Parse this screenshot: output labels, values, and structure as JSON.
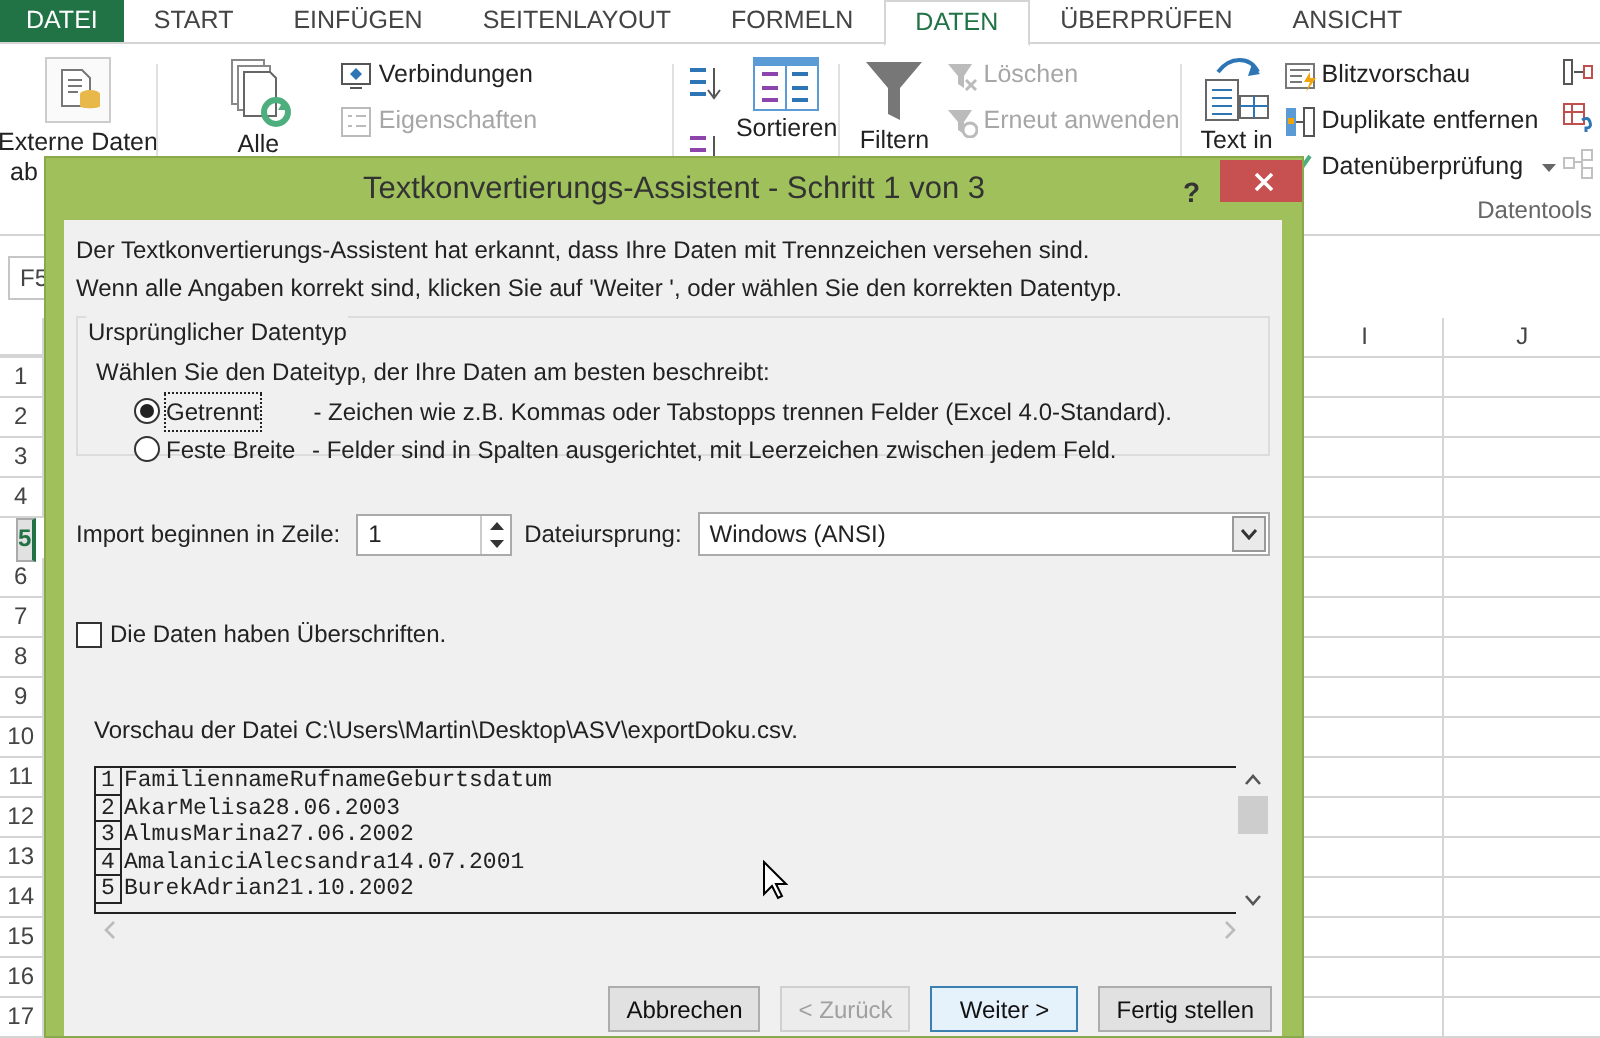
{
  "ribbon_tabs": [
    {
      "label": "DATEI",
      "kind": "file",
      "selected": false
    },
    {
      "label": "START",
      "kind": "tab",
      "selected": false
    },
    {
      "label": "EINFÜGEN",
      "kind": "tab",
      "selected": false
    },
    {
      "label": "SEITENLAYOUT",
      "kind": "tab",
      "selected": false
    },
    {
      "label": "FORMELN",
      "kind": "tab",
      "selected": false
    },
    {
      "label": "DATEN",
      "kind": "tab",
      "selected": true
    },
    {
      "label": "ÜBERPRÜFEN",
      "kind": "tab",
      "selected": false
    },
    {
      "label": "ANSICHT",
      "kind": "tab",
      "selected": false
    }
  ],
  "ribbon": {
    "columns": [
      {
        "kind": "large",
        "lines": [
          "Externe Daten",
          "ab"
        ]
      },
      {
        "kind": "large",
        "lines": [
          "Alle"
        ]
      },
      {
        "kind": "small",
        "items": [
          {
            "label": "Verbindungen",
            "disabled": false
          },
          {
            "label": "Eigenschaften",
            "disabled": true
          }
        ]
      },
      {
        "kind": "sort",
        "items": [
          {
            "disabled": false
          },
          {
            "disabled": false
          }
        ]
      },
      {
        "kind": "large",
        "lines": [
          "Sortieren"
        ]
      },
      {
        "kind": "large",
        "lines": [
          "Filtern"
        ]
      },
      {
        "kind": "small",
        "items": [
          {
            "label": "Löschen",
            "disabled": true
          },
          {
            "label": "Erneut anwenden",
            "disabled": true
          }
        ]
      },
      {
        "kind": "large",
        "lines": [
          "Text in"
        ]
      },
      {
        "kind": "small",
        "items": [
          {
            "label": "Blitzvorschau",
            "disabled": false
          },
          {
            "label": "Duplikate entfernen",
            "disabled": false
          },
          {
            "label": "Datenüberprüfung",
            "disabled": false,
            "dropdown": true
          }
        ]
      },
      {
        "kind": "icons",
        "items": [
          {
            "disabled": false
          },
          {
            "disabled": false
          },
          {
            "disabled": true
          }
        ]
      }
    ],
    "group_label": "Datentools"
  },
  "name_box": "F5",
  "columns": [
    "I",
    "J"
  ],
  "rows": [
    {
      "label": "1",
      "selected": false
    },
    {
      "label": "2",
      "selected": false
    },
    {
      "label": "3",
      "selected": false
    },
    {
      "label": "4",
      "selected": false
    },
    {
      "label": "5",
      "selected": true
    },
    {
      "label": "6",
      "selected": false
    },
    {
      "label": "7",
      "selected": false
    },
    {
      "label": "8",
      "selected": false
    },
    {
      "label": "9",
      "selected": false
    },
    {
      "label": "10",
      "selected": false
    },
    {
      "label": "11",
      "selected": false
    },
    {
      "label": "12",
      "selected": false
    },
    {
      "label": "13",
      "selected": false
    },
    {
      "label": "14",
      "selected": false
    },
    {
      "label": "15",
      "selected": false
    },
    {
      "label": "16",
      "selected": false
    },
    {
      "label": "17",
      "selected": false
    }
  ],
  "dialog": {
    "title": "Textkonvertierungs-Assistent - Schritt 1 von 3",
    "help": "?",
    "intro": [
      "Der Textkonvertierungs-Assistent hat erkannt, dass Ihre Daten mit Trennzeichen versehen sind.",
      "Wenn alle Angaben korrekt sind, klicken Sie auf 'Weiter ', oder wählen Sie den korrekten Datentyp."
    ],
    "group_title": "Ursprünglicher Datentyp",
    "prompt": "Wählen Sie den Dateityp, der Ihre Daten am besten beschreibt:",
    "options": [
      {
        "label": "Getrennt",
        "description": "- Zeichen wie z.B. Kommas oder Tabstopps trennen Felder (Excel 4.0-Standard).",
        "selected": true
      },
      {
        "label": "Feste Breite",
        "description": "- Felder sind in Spalten ausgerichtet, mit Leerzeichen zwischen jedem Feld.",
        "selected": false
      }
    ],
    "start_row": {
      "label": "Import beginnen in Zeile:",
      "value": "1"
    },
    "origin": {
      "label": "Dateiursprung:",
      "value": "Windows (ANSI)"
    },
    "headers": {
      "label": "Die Daten haben Überschriften.",
      "checked": false
    },
    "preview": {
      "label": "Vorschau der Datei C:\\Users\\Martin\\Desktop\\ASV\\exportDoku.csv.",
      "lines": [
        {
          "number": "1",
          "text": "FamiliennameRufnameGeburtsdatum"
        },
        {
          "number": "2",
          "text": "AkarMelisa28.06.2003"
        },
        {
          "number": "3",
          "text": "AlmusMarina27.06.2002"
        },
        {
          "number": "4",
          "text": "AmalaniciAlecsandra14.07.2001"
        },
        {
          "number": "5",
          "text": "BurekAdrian21.10.2002"
        }
      ]
    },
    "buttons": [
      {
        "label": "Abbrechen",
        "disabled": false,
        "default": false
      },
      {
        "label": "< Zurück",
        "disabled": true,
        "default": false
      },
      {
        "label": "Weiter >",
        "disabled": false,
        "default": true
      },
      {
        "label": "Fertig stellen",
        "disabled": false,
        "default": false
      }
    ]
  }
}
